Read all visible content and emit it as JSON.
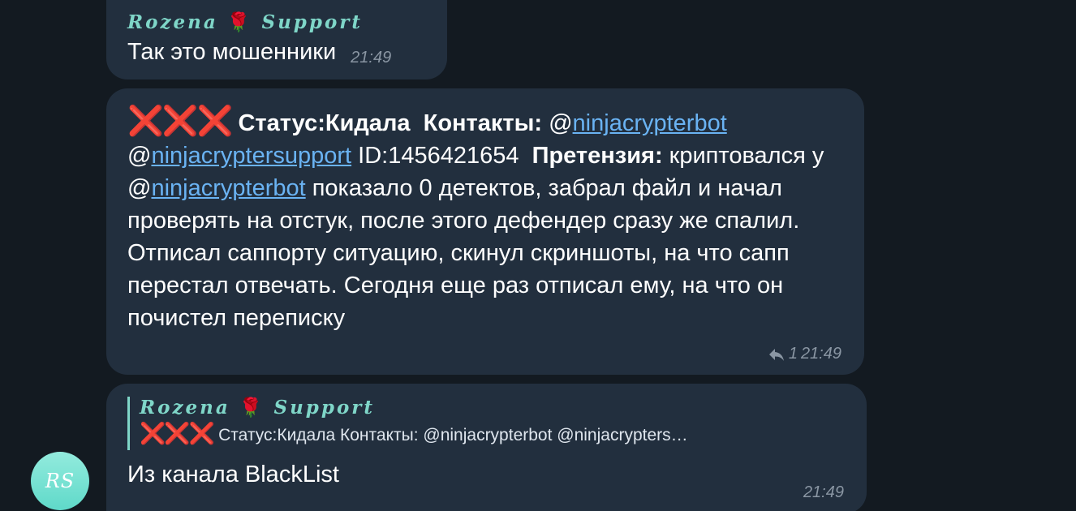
{
  "messages": [
    {
      "sender": "Rozena",
      "sender_suffix": "Support",
      "text": "Так это мошенники",
      "time": "21:49"
    },
    {
      "status_label": "Статус:Кидала",
      "contacts_label": "Контакты:",
      "contact_at_1": "@",
      "contact_1": "ninjacrypterbot",
      "contact_at_2": "@",
      "contact_2": "ninjacryptersupport",
      "id_text": "ID:1456421654",
      "claim_label": "Претензия:",
      "text_part1": "криптовался у ",
      "mention_at": "@",
      "mention": "ninjacrypterbot",
      "text_part2": " показало 0 детектов, забрал файл и начал проверять на отстук, после этого дефендер сразу же спалил. Отписал саппорту ситуацию, скинул скриншоты, на что сапп перестал отвечать. Сегодня еще раз отписал ему, на что он почистел переписку",
      "replies": "1",
      "time": "21:49"
    },
    {
      "quote_sender": "Rozena",
      "quote_sender_suffix": "Support",
      "quote_text": "Статус:Кидала  Контакты: @ninjacrypterbot @ninjacrypters…",
      "text": "Из канала BlackList",
      "time": "21:49"
    }
  ],
  "avatar_initials": "RS",
  "colors": {
    "background": "#131a21",
    "bubble": "#222f3e",
    "sender_name": "#7fd6c8",
    "link": "#6ab3f3",
    "cross": "#e1252a",
    "timestamp": "#8a96a3",
    "avatar": "#6fe0d0"
  },
  "icons": {
    "rose": "rose-emoji",
    "cross": "cross-mark-emoji",
    "reply": "reply-arrow-icon"
  }
}
